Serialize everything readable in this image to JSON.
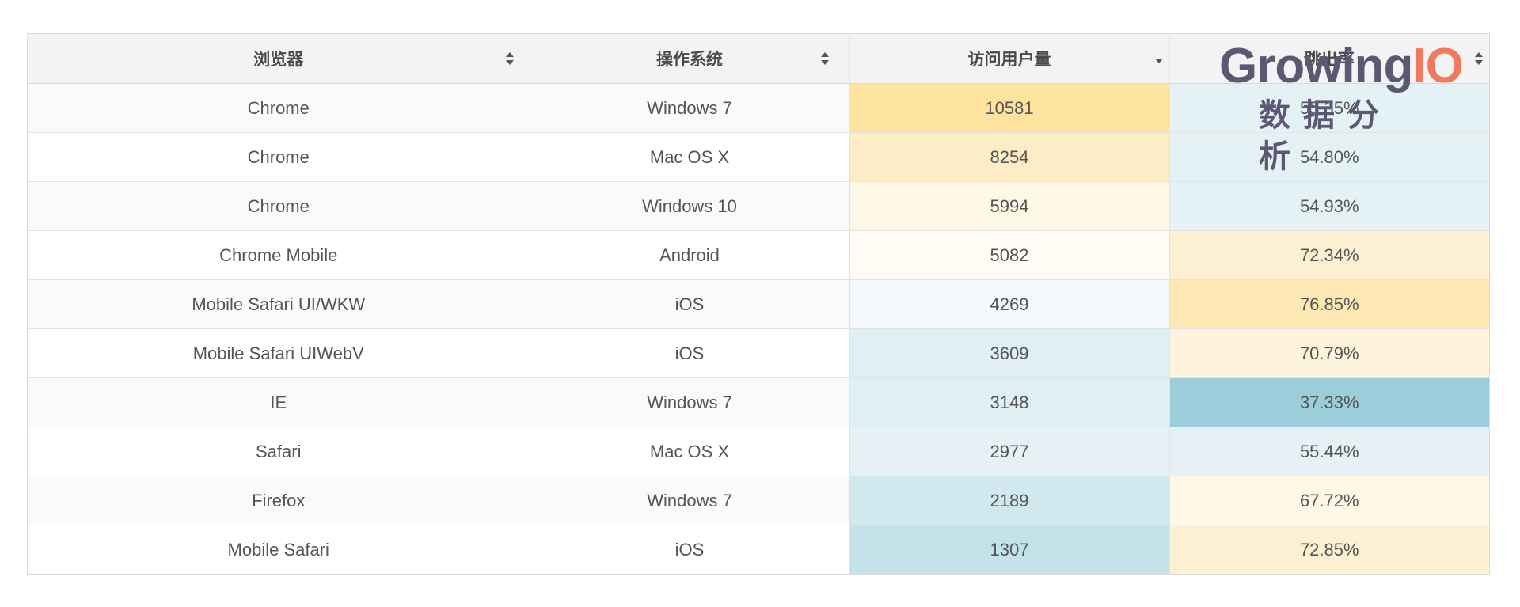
{
  "table": {
    "columns": [
      {
        "label": "浏览器",
        "sort": "both"
      },
      {
        "label": "操作系统",
        "sort": "both"
      },
      {
        "label": "访问用户量",
        "sort": "desc"
      },
      {
        "label": "跳出率",
        "sort": "both"
      }
    ],
    "rows": [
      {
        "browser": "Chrome",
        "os": "Windows 7",
        "users": "10581",
        "bounce": "55.35%"
      },
      {
        "browser": "Chrome",
        "os": "Mac OS X",
        "users": "8254",
        "bounce": "54.80%"
      },
      {
        "browser": "Chrome",
        "os": "Windows 10",
        "users": "5994",
        "bounce": "54.93%"
      },
      {
        "browser": "Chrome Mobile",
        "os": "Android",
        "users": "5082",
        "bounce": "72.34%"
      },
      {
        "browser": "Mobile Safari UI/WKW",
        "os": "iOS",
        "users": "4269",
        "bounce": "76.85%"
      },
      {
        "browser": "Mobile Safari UIWebV",
        "os": "iOS",
        "users": "3609",
        "bounce": "70.79%"
      },
      {
        "browser": "IE",
        "os": "Windows 7",
        "users": "3148",
        "bounce": "37.33%"
      },
      {
        "browser": "Safari",
        "os": "Mac OS X",
        "users": "2977",
        "bounce": "55.44%"
      },
      {
        "browser": "Firefox",
        "os": "Windows 7",
        "users": "2189",
        "bounce": "67.72%"
      },
      {
        "browser": "Mobile Safari",
        "os": "iOS",
        "users": "1307",
        "bounce": "72.85%"
      }
    ],
    "users_cell_colors": [
      "#fde39d",
      "#fdedc6",
      "#fef8e7",
      "#fefcf5",
      "#f5f9fb",
      "#e0eff4",
      "#e0eff4",
      "#e5f1f5",
      "#d2e8ef",
      "#c4e2e9"
    ],
    "bounce_cell_colors": [
      "#e4f1f5",
      "#e4f1f5",
      "#e4f1f5",
      "#fdf0d2",
      "#fde8b4",
      "#fef3dc",
      "#9bcedb",
      "#e5f1f5",
      "#fef7e6",
      "#fdf0d2"
    ]
  },
  "logo": {
    "word_main": "Growing",
    "word_accent": "IO",
    "sub": "数据分析",
    "colors": {
      "main": "#5c5874",
      "accent": "#f0795e"
    }
  }
}
